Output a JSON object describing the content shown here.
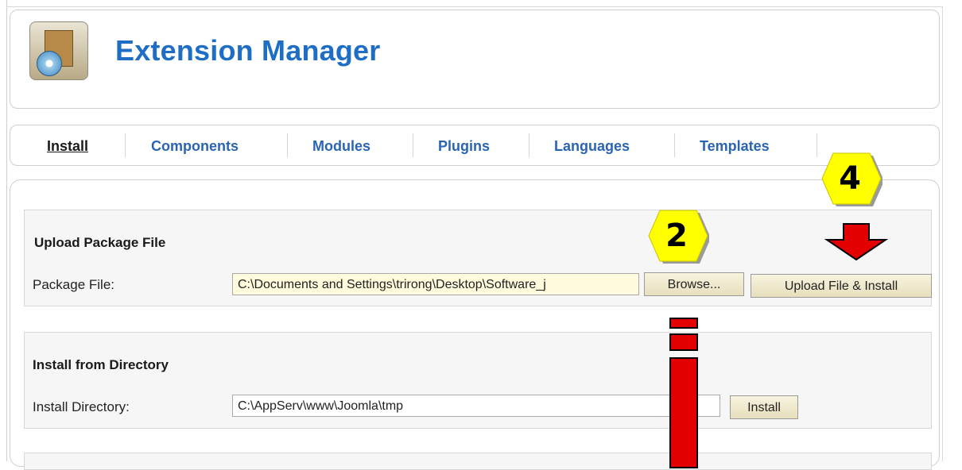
{
  "header": {
    "title": "Extension Manager",
    "icon": "package-disc-icon"
  },
  "tabs": [
    {
      "label": "Install",
      "active": true
    },
    {
      "label": "Components"
    },
    {
      "label": "Modules"
    },
    {
      "label": "Plugins"
    },
    {
      "label": "Languages"
    },
    {
      "label": "Templates"
    }
  ],
  "upload": {
    "legend": "Upload Package File",
    "label": "Package File:",
    "value": "C:\\Documents and Settings\\trirong\\Desktop\\Software_j",
    "browse_label": "Browse...",
    "install_label": "Upload File & Install"
  },
  "directory": {
    "legend": "Install from Directory",
    "label": "Install Directory:",
    "value": "C:\\AppServ\\www\\Joomla\\tmp",
    "install_label": "Install"
  },
  "annotations": {
    "step_browse": "2",
    "step_install": "4",
    "badge_color": "#ffff00",
    "arrow_color": "#e30000"
  }
}
